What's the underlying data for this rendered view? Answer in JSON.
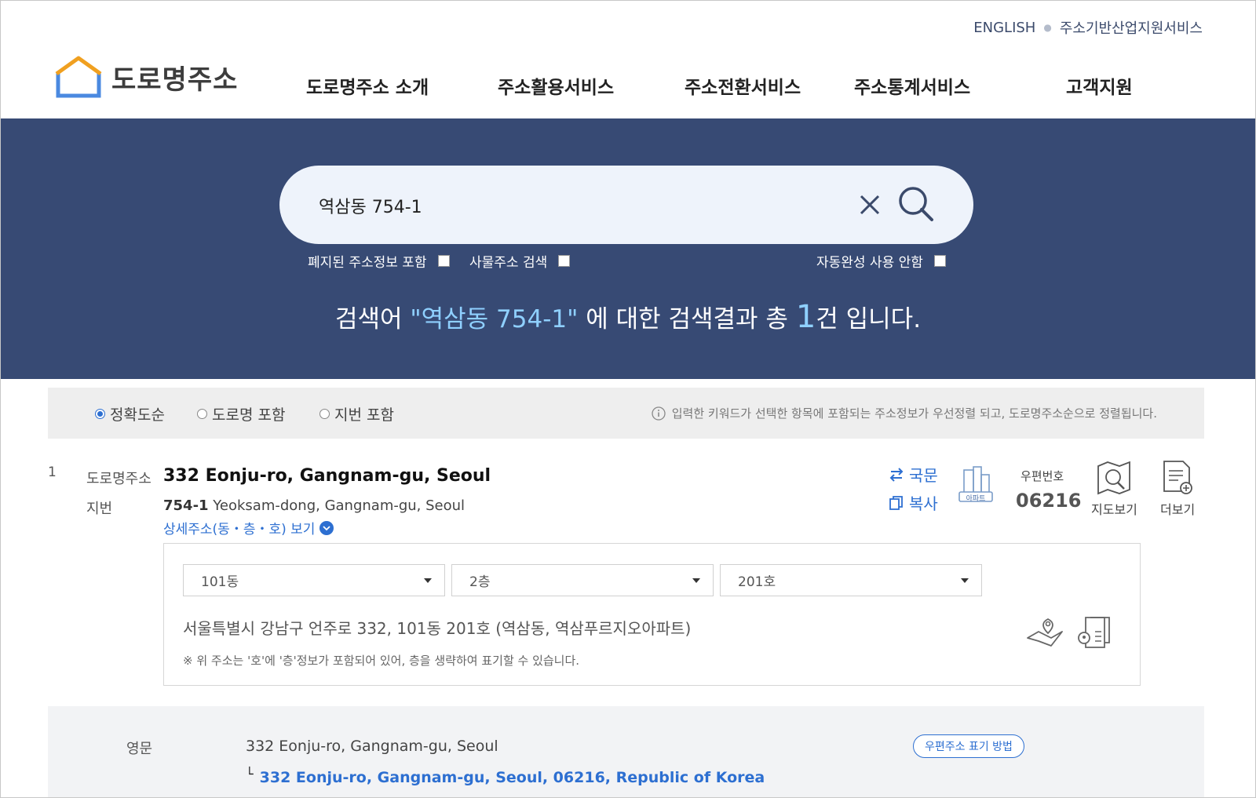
{
  "header": {
    "util_links": [
      "ENGLISH",
      "주소기반산업지원서비스"
    ],
    "logo_text": "도로명주소",
    "nav": [
      "도로명주소 소개",
      "주소활용서비스",
      "주소전환서비스",
      "주소통계서비스",
      "고객지원"
    ]
  },
  "search": {
    "value": "역삼동 754-1",
    "options": [
      "폐지된 주소정보 포함",
      "사물주소 검색",
      "자동완성 사용 안함"
    ],
    "summary_prefix": "검색어 ",
    "summary_query": "\"역삼동 754-1\"",
    "summary_mid": " 에 대한 검색결과 총 ",
    "summary_count": "1",
    "summary_suffix": "건 입니다."
  },
  "sort": {
    "options": [
      "정확도순",
      "도로명 포함",
      "지번 포함"
    ],
    "selected": "정확도순",
    "note": "입력한 키워드가 선택한 항목에 포함되는 주소정보가 우선정렬 되고, 도로명주소순으로 정렬됩니다."
  },
  "result": {
    "index": "1",
    "road_label": "도로명주소",
    "road_address": "332 Eonju-ro, Gangnam-gu, Seoul",
    "jibun_label": "지번",
    "jibun_number": "754-1",
    "jibun_rest": " Yeoksam-dong, Gangnam-gu, Seoul",
    "detail_link": "상세주소(동・층・호) 보기",
    "actions": {
      "korean": "국문",
      "copy": "복사",
      "apt_badge": "아파트"
    },
    "zip_label": "우편번호",
    "zip_code": "06216",
    "tools": [
      "지도보기",
      "더보기"
    ],
    "detail": {
      "selects": [
        "101동",
        "2층",
        "201호"
      ],
      "full_address": "서울특별시 강남구 언주로 332, 101동 201호 (역삼동, 역삼푸르지오아파트)",
      "note": "※ 위 주소는 '호'에 '층'정보가 포함되어 있어, 층을 생략하여 표기할 수 있습니다."
    },
    "english": {
      "label": "영문",
      "address": "332 Eonju-ro, Gangnam-gu, Seoul",
      "full": "332 Eonju-ro, Gangnam-gu, Seoul, 06216, Republic of Korea",
      "postal_button": "우편주소 표기 방법"
    }
  },
  "colors": {
    "hero_bg": "#374a74",
    "accent": "#2d6fd1",
    "query_highlight": "#8fd0ff"
  }
}
